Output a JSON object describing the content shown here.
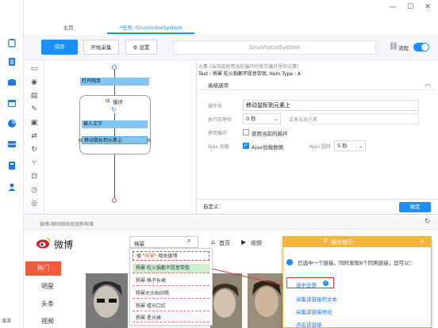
{
  "window": {
    "tabs": [
      {
        "label": "主页"
      },
      {
        "label": "*任务: SinaVisitorSystem"
      }
    ]
  },
  "sidebar": {
    "icons": [
      "clipboard-icon",
      "list-icon",
      "cloud-icon",
      "calendar-icon",
      "pie-chart-icon",
      "grid-icon",
      "book-icon",
      "user-icon"
    ],
    "bottom_text": "谋谋"
  },
  "toolbar": {
    "save_label": "保存",
    "start_label": "开始采集",
    "settings_label": "设置",
    "task_name": "SinaVisitorSystem",
    "flow_label": "流程"
  },
  "workflow": {
    "nodes": {
      "open_page": "打开网页",
      "loop": "循环",
      "input_text": "输入文字",
      "move_mouse": "移动鼠标到元素上"
    }
  },
  "props": {
    "hint": "元素 (当勾选使用当前循环时显示循环里的元素)",
    "text_line": "Text : 杨幂 吃火锅都不愿意带我, Item Type : A",
    "adv_title": "高级选项",
    "op_name_label": "操作名",
    "op_name_value": "移动鼠标到元素上",
    "wait_label": "执行前等待",
    "wait_value": "0 秒",
    "wait_or": "或者出现元素",
    "use_loop_label": "使用循环",
    "use_current_loop": "使用当前的循环",
    "ajax_label": "Ajax 加载",
    "ajax_check": "Ajax加载数据",
    "ajax_timeout_label": "Ajax 超时",
    "ajax_timeout_value": "5 秒",
    "custom_label": "自定义",
    "ok_label": "确定"
  },
  "browser": {
    "address": "微博-随时随地发现新鲜事",
    "search_value": "杨幂",
    "nav_home": "首页",
    "nav_video": "视频",
    "logo_text": "微博",
    "suggestions": [
      {
        "pre": "搜 \"",
        "hit": "杨幂",
        "post": "\" 相关微博"
      },
      {
        "pre": "",
        "hit": "",
        "post": "杨幂 吃火锅都不愿意带我"
      },
      {
        "pre": "",
        "hit": "",
        "post": "杨幂 格子长裙"
      },
      {
        "pre": "",
        "hit": "",
        "post": "杨幂大头贴印照"
      },
      {
        "pre": "",
        "hit": "",
        "post": "杨幂 嘻光口红"
      },
      {
        "pre": "",
        "hit": "",
        "post": "杨幂 星光裙"
      }
    ],
    "hot_tab": "热门",
    "hot_items": [
      "明星",
      "头条",
      "视频"
    ]
  },
  "popover": {
    "title": "操作提示",
    "info": "已选中一个链接，同时发现6个同类链接，您可以：",
    "select_all": "选中全部",
    "link_text": "采集该链接的文本",
    "link_addr": "采集该链接地址",
    "click_link": "点击该链接"
  },
  "colors": {
    "accent": "#1890ff",
    "weibo_red": "#f05a3f",
    "popover_header": "#f7b53a",
    "highlight_red": "#e03535"
  }
}
